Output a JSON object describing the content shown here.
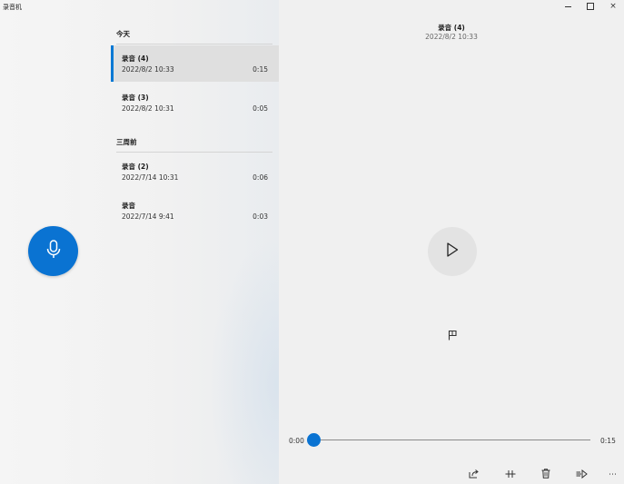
{
  "app": {
    "title": "录音机",
    "window_controls": {
      "minimize": "minimize",
      "maximize": "maximize",
      "close": "×"
    }
  },
  "list": {
    "sections": [
      {
        "header": "今天",
        "items": [
          {
            "name": "录音 (4)",
            "date": "2022/8/2 10:33",
            "duration": "0:15",
            "selected": true
          },
          {
            "name": "录音 (3)",
            "date": "2022/8/2 10:31",
            "duration": "0:05",
            "selected": false
          }
        ]
      },
      {
        "header": "三周前",
        "items": [
          {
            "name": "录音 (2)",
            "date": "2022/7/14 10:31",
            "duration": "0:06",
            "selected": false
          },
          {
            "name": "录音",
            "date": "2022/7/14 9:41",
            "duration": "0:03",
            "selected": false
          }
        ]
      }
    ]
  },
  "record_button": {
    "icon": "microphone-icon"
  },
  "detail": {
    "title": "录音 (4)",
    "date": "2022/8/2 10:33",
    "play_icon": "play-icon",
    "marker_icon": "flag-icon",
    "current_time": "0:00",
    "total_time": "0:15",
    "progress": 0
  },
  "toolbar": {
    "items": [
      "share-icon",
      "trim-icon",
      "delete-icon",
      "speed-icon",
      "more-icon"
    ],
    "more_label": "⋯"
  },
  "colors": {
    "accent": "#0a73d2",
    "selected_row": "#dfdfdf"
  }
}
